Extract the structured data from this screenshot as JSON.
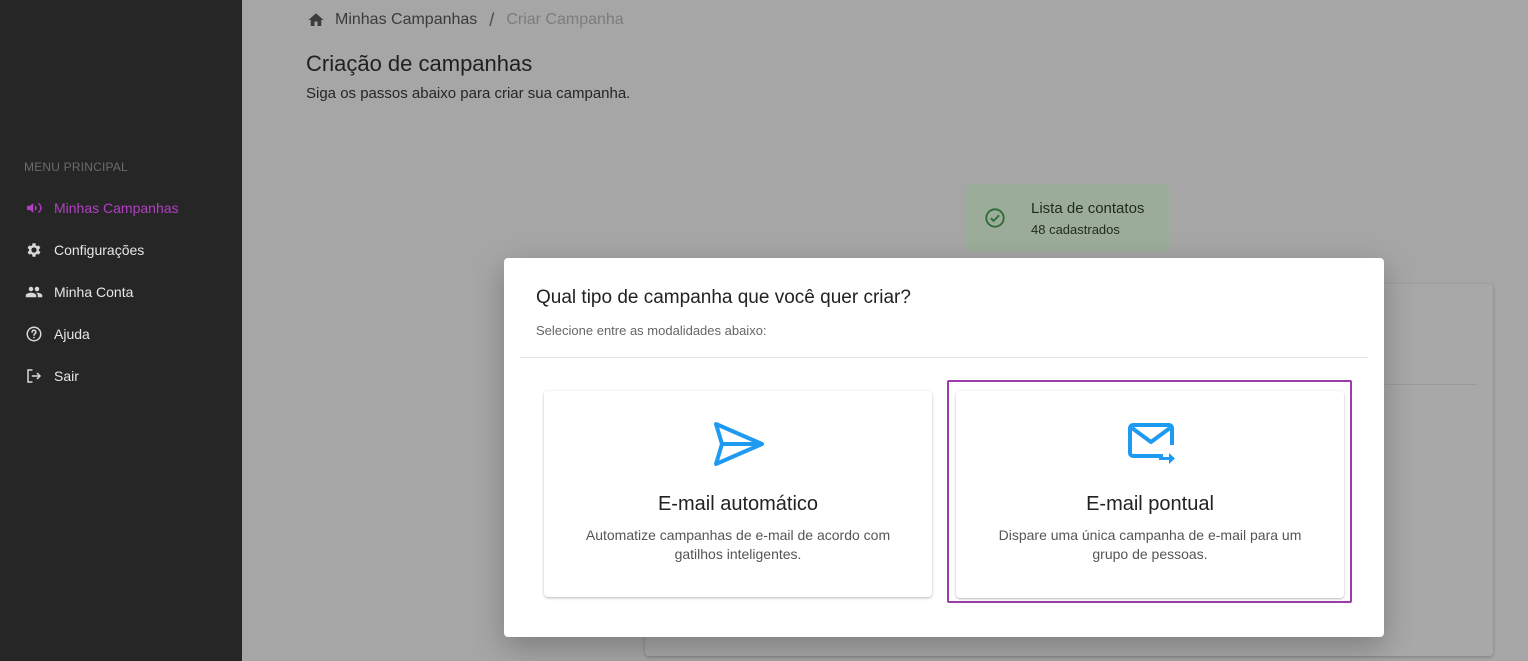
{
  "sidebar": {
    "heading": "MENU PRINCIPAL",
    "items": [
      {
        "label": "Minhas Campanhas",
        "icon": "megaphone-icon",
        "active": true
      },
      {
        "label": "Configurações",
        "icon": "gear-icon",
        "active": false
      },
      {
        "label": "Minha Conta",
        "icon": "people-icon",
        "active": false
      },
      {
        "label": "Ajuda",
        "icon": "help-circle-icon",
        "active": false
      },
      {
        "label": "Sair",
        "icon": "logout-icon",
        "active": false
      }
    ]
  },
  "breadcrumb": {
    "home_icon": "home-icon",
    "items": [
      "Minhas Campanhas",
      "Criar Campanha"
    ],
    "separator": "/"
  },
  "page": {
    "title": "Criação de campanhas",
    "subtitle": "Siga os passos abaixo para criar sua campanha."
  },
  "contacts_card": {
    "title": "Lista de contatos",
    "subtitle": "48 cadastrados",
    "icon": "check-circle-icon"
  },
  "modal": {
    "title": "Qual tipo de campanha que você quer criar?",
    "subtitle": "Selecione entre as modalidades abaixo:",
    "options": [
      {
        "title": "E-mail automático",
        "description": "Automatize campanhas de e-mail de acordo com gatilhos inteligentes.",
        "icon": "send-icon",
        "selected": false
      },
      {
        "title": "E-mail pontual",
        "description": "Dispare uma única campanha de e-mail para um grupo de pessoas.",
        "icon": "mail-forward-icon",
        "selected": true
      }
    ]
  },
  "colors": {
    "accent": "#b13fc4",
    "selection_border": "#9b3da8",
    "icon_blue": "#1e9bf0",
    "sidebar_bg": "#262626"
  }
}
